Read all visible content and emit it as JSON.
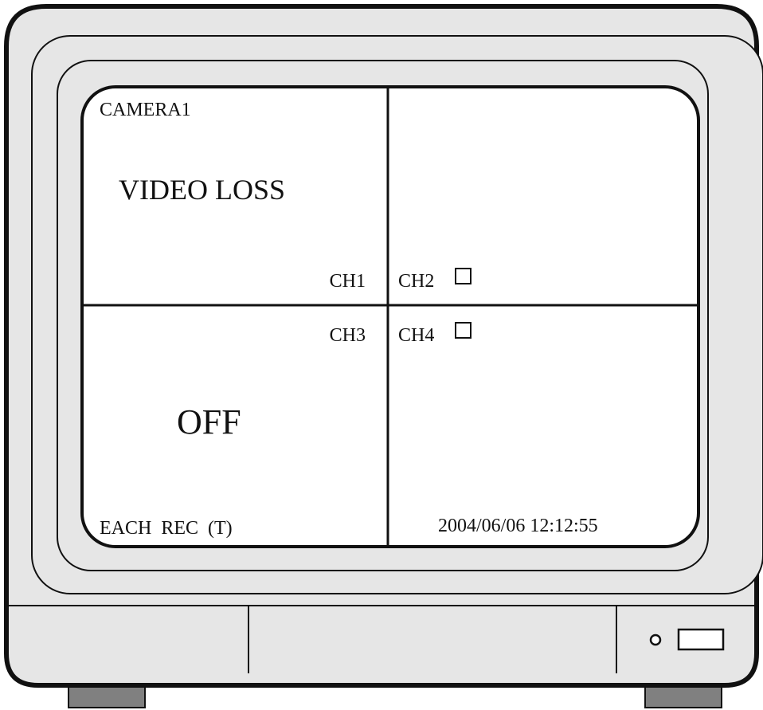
{
  "colors": {
    "bezel": "#e6e6e6",
    "outline": "#111111",
    "screen": "#ffffff",
    "feet": "#808080"
  },
  "screen": {
    "ch1": {
      "camera_title": "CAMERA1",
      "status": "VIDEO LOSS",
      "channel": "CH1"
    },
    "ch2": {
      "channel": "CH2",
      "indicator": "☐"
    },
    "ch3": {
      "channel": "CH3",
      "status": "OFF",
      "record_mode": "EACH  REC  (T)"
    },
    "ch4": {
      "channel": "CH4",
      "indicator": "☐",
      "datetime": "2004/06/06 12:12:55"
    }
  },
  "front_panel": {
    "power_led": "power-led-icon",
    "ir_window": "ir-sensor-icon"
  }
}
